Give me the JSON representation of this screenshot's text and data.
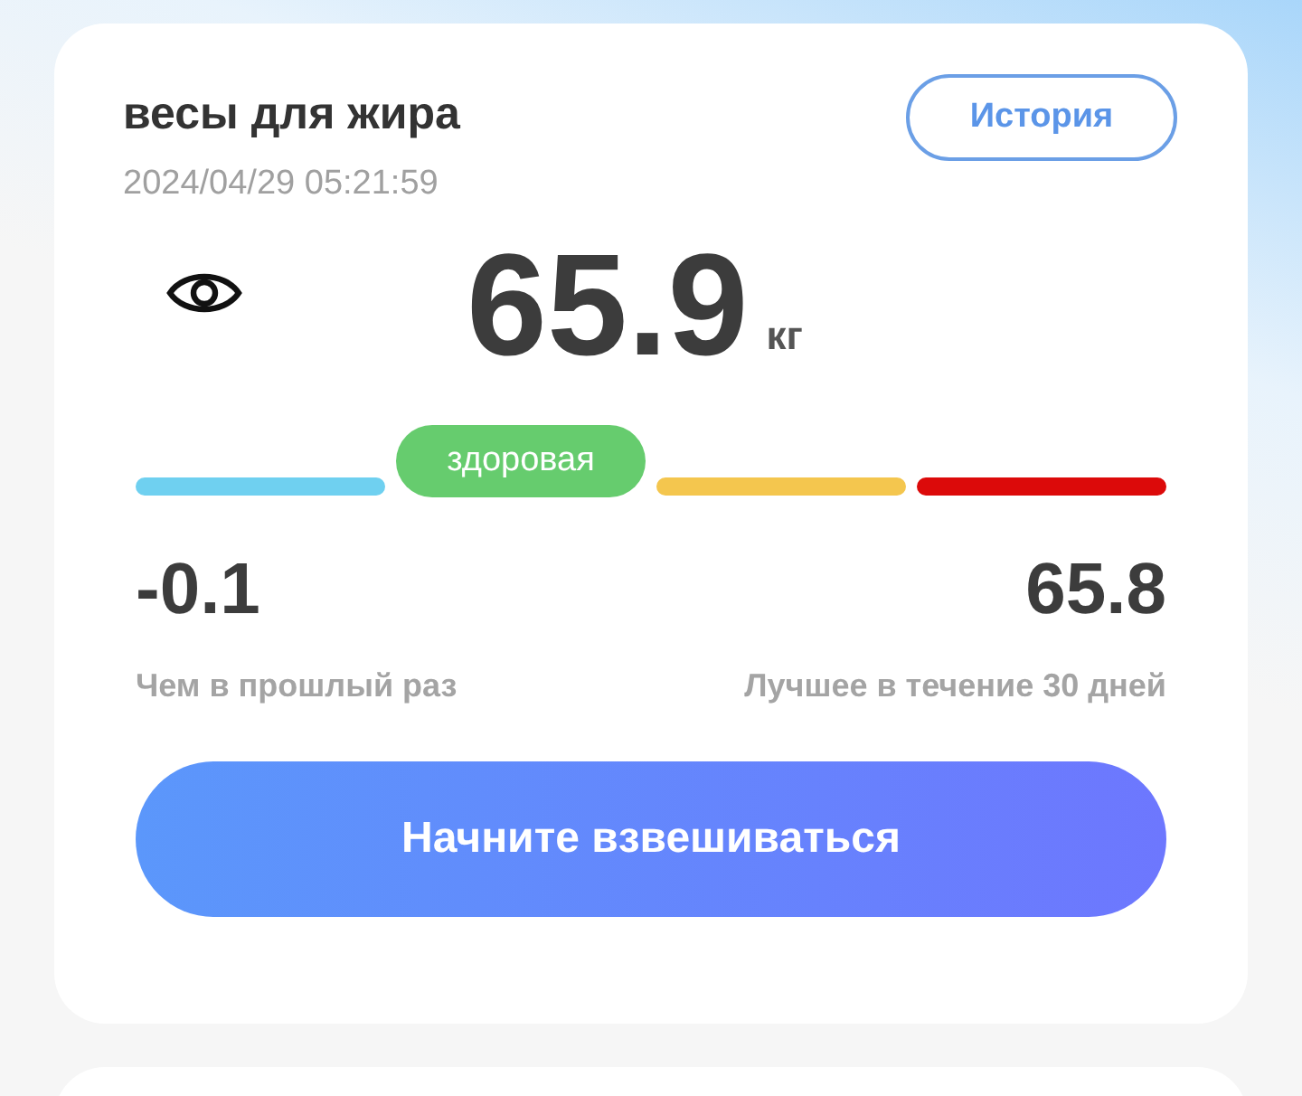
{
  "card": {
    "title": "весы для жира",
    "timestamp": "2024/04/29 05:21:59",
    "history_button": "История",
    "weight": "65.9",
    "unit": "кг",
    "scale": [
      {
        "color": "#6fd0f0",
        "selected": false
      },
      {
        "color": "#66cc6e",
        "selected": true,
        "label": "здоровая"
      },
      {
        "color": "#f4c64e",
        "selected": false
      },
      {
        "color": "#dc0a0a",
        "selected": false
      }
    ],
    "stats": [
      {
        "value": "-0.1",
        "label": "Чем в прошлый раз"
      },
      {
        "value": "65.8",
        "label": "Лучшее в течение 30 дней"
      }
    ],
    "action_button": "Начните взвешиваться"
  }
}
